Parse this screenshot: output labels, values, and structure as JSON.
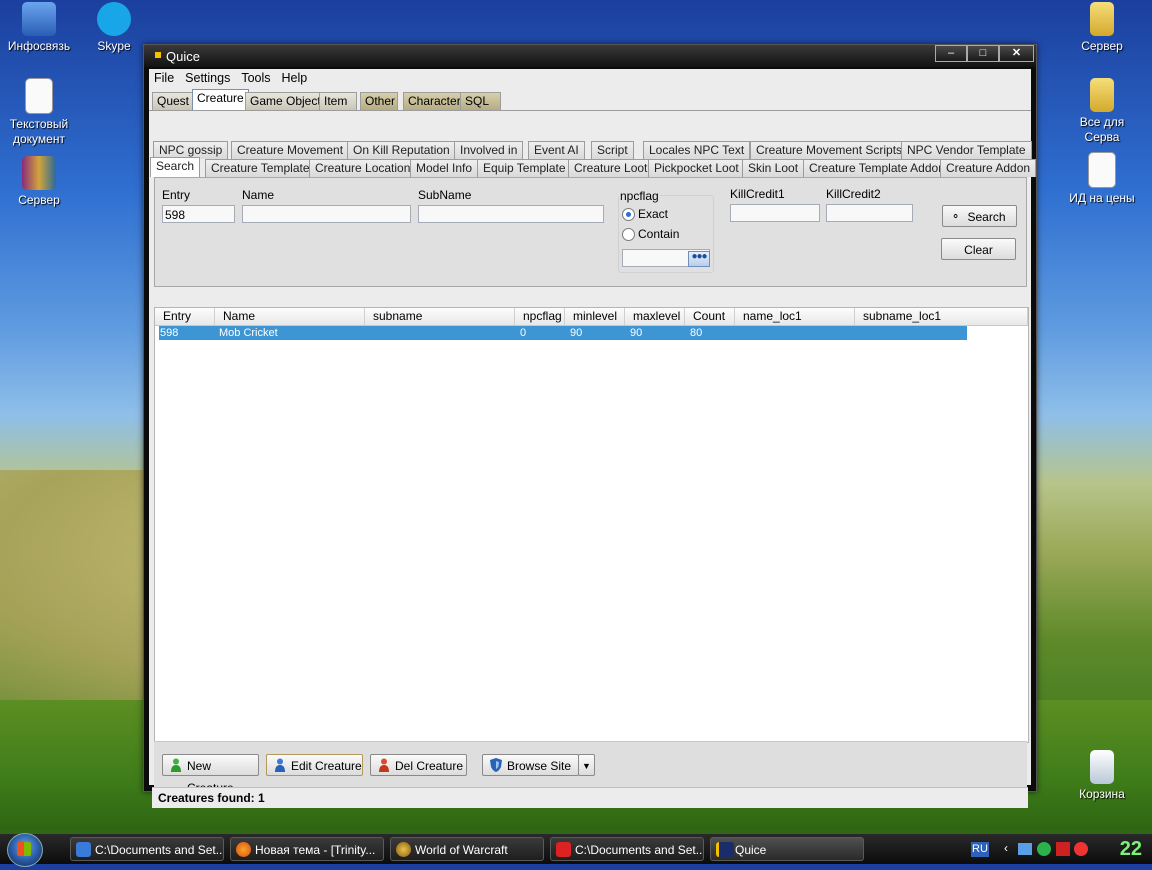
{
  "desktop": {
    "icons": [
      {
        "label": "Инфосвязь"
      },
      {
        "label": "Skype"
      },
      {
        "label": "Текстовый документ"
      },
      {
        "label": "Сервер"
      },
      {
        "label": "Сервер"
      },
      {
        "label": "Все для Серва"
      },
      {
        "label": "ИД на цены"
      },
      {
        "label": "Корзина"
      }
    ]
  },
  "window": {
    "title": "Quice",
    "menu": [
      "File",
      "Settings",
      "Tools",
      "Help"
    ],
    "top_tabs": [
      "Quest",
      "Creature",
      "Game Object",
      "Item",
      "Other",
      "Character",
      "SQL"
    ],
    "active_top_tab": "Creature",
    "sub_tabs_row1": [
      "NPC gossip",
      "Creature Movement",
      "On Kill Reputation",
      "Involved in",
      "Event AI",
      "Script",
      "Locales NPC Text",
      "Creature Movement Scripts",
      "NPC Vendor Template"
    ],
    "sub_tabs_row2": [
      "Search",
      "Creature Template",
      "Creature Location",
      "Model Info",
      "Equip Template",
      "Creature Loot",
      "Pickpocket Loot",
      "Skin Loot",
      "Creature Template Addon",
      "Creature Addon"
    ],
    "search": {
      "entry_label": "Entry",
      "entry_value": "598",
      "name_label": "Name",
      "name_value": "",
      "subname_label": "SubName",
      "subname_value": "",
      "npcflag_label": "npcflag",
      "exact_label": "Exact",
      "contain_label": "Contain",
      "npcflag_mode": "Exact",
      "killcredit1_label": "KillCredit1",
      "killcredit2_label": "KillCredit2",
      "search_button": "Search",
      "clear_button": "Clear"
    },
    "grid": {
      "columns": [
        "Entry",
        "Name",
        "subname",
        "npcflag",
        "minlevel",
        "maxlevel",
        "Count",
        "name_loc1",
        "subname_loc1"
      ],
      "rows": [
        {
          "entry": "598",
          "name": "Mob Cricket",
          "subname": "",
          "npcflag": "0",
          "minlevel": "90",
          "maxlevel": "90",
          "count": "80",
          "name_loc1": "",
          "subname_loc1": ""
        }
      ]
    },
    "actions": {
      "new": "New Creature",
      "edit": "Edit Creature",
      "del": "Del Creature",
      "browse": "Browse Site"
    },
    "status": "Creatures found: 1"
  },
  "taskbar": {
    "items": [
      {
        "label": "C:\\Documents and Set...",
        "icon": "explorer-icon"
      },
      {
        "label": "Новая тема - [Trinity...",
        "icon": "firefox-icon"
      },
      {
        "label": "World of Warcraft",
        "icon": "wow-icon"
      },
      {
        "label": "C:\\Documents and Set...",
        "icon": "explorer-icon"
      },
      {
        "label": "Quice",
        "icon": "quice-icon"
      }
    ],
    "lang": "RU",
    "clock": "22"
  }
}
